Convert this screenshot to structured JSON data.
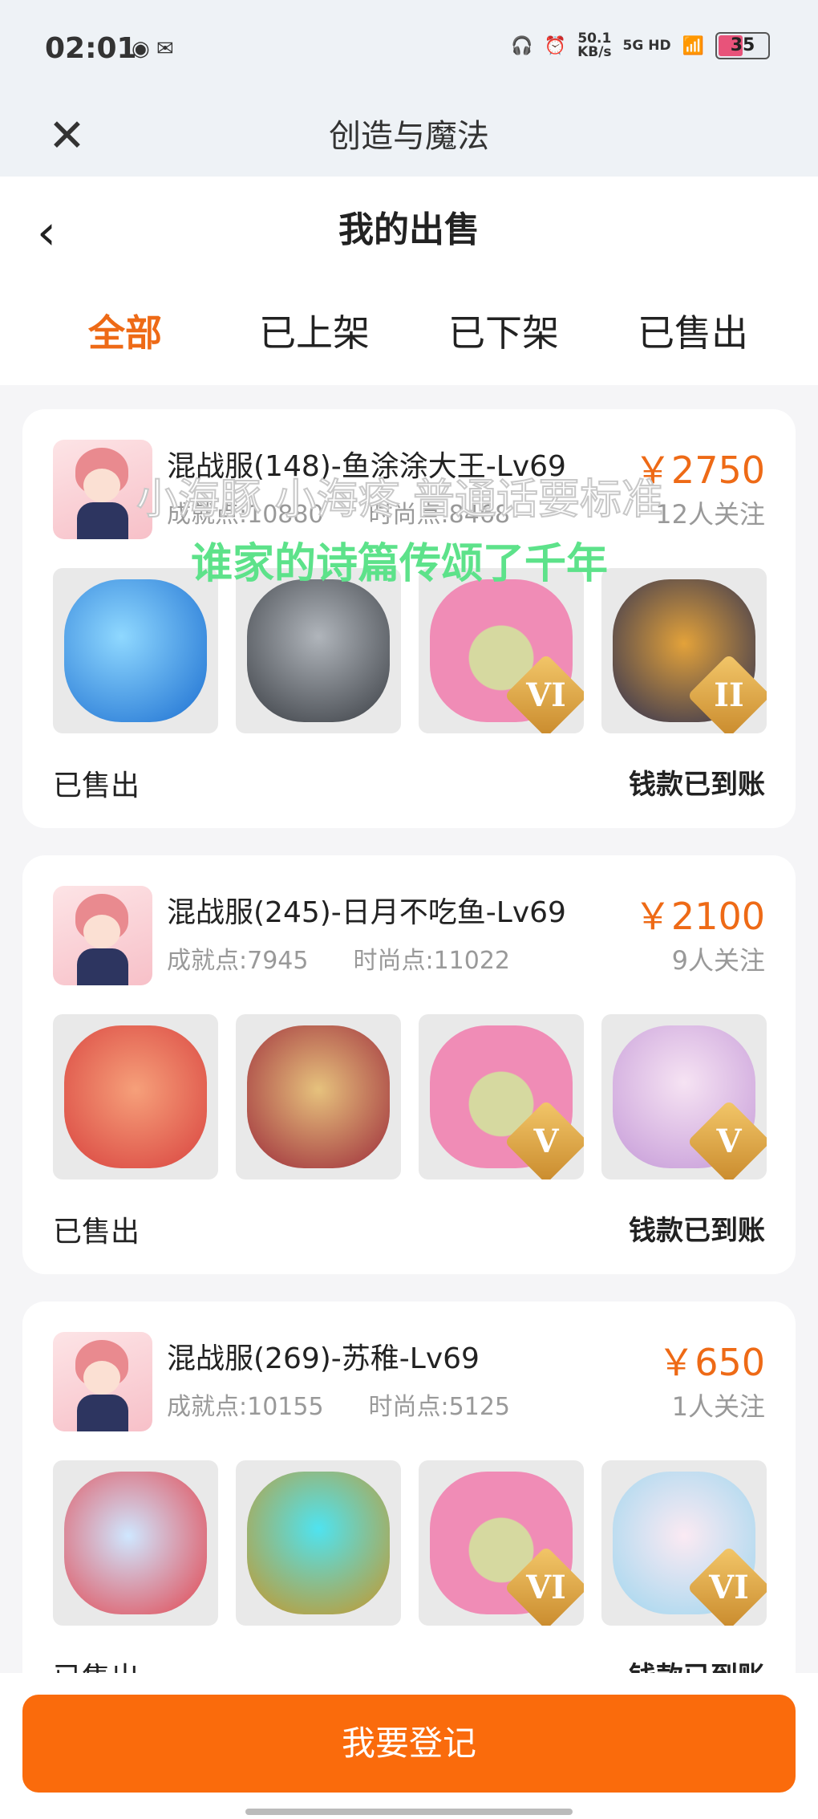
{
  "status_bar": {
    "time": "02:01",
    "speed_value": "50.1",
    "speed_unit": "KB/s",
    "network": "5G HD",
    "battery": "35"
  },
  "nav": {
    "title": "创造与魔法",
    "page_title": "我的出售"
  },
  "tabs": [
    {
      "label": "全部"
    },
    {
      "label": "已上架"
    },
    {
      "label": "已下架"
    },
    {
      "label": "已售出"
    }
  ],
  "overlay": {
    "line1": "小海豚 小海疼 普通话要标准",
    "line2": "谁家的诗篇传颂了千年"
  },
  "listings": [
    {
      "name": "混战服(148)-鱼涂涂大王-Lv69",
      "achievement": "成就点:10880",
      "fashion": "时尚点:8468",
      "price": "￥2750",
      "followers": "12人关注",
      "status": "已售出",
      "payment": "钱款已到账",
      "items": [
        {
          "icon": "whale-mount",
          "rank": ""
        },
        {
          "icon": "dragon-mount",
          "rank": ""
        },
        {
          "icon": "pink-bear",
          "rank": "VI"
        },
        {
          "icon": "golden-dragon",
          "rank": "II"
        }
      ]
    },
    {
      "name": "混战服(245)-日月不吃鱼-Lv69",
      "achievement": "成就点:7945",
      "fashion": "时尚点:11022",
      "price": "￥2100",
      "followers": "9人关注",
      "status": "已售出",
      "payment": "钱款已到账",
      "items": [
        {
          "icon": "antler-dragon",
          "rank": ""
        },
        {
          "icon": "crimson-dragon",
          "rank": ""
        },
        {
          "icon": "pink-bear",
          "rank": "V"
        },
        {
          "icon": "fox-girl",
          "rank": "V"
        }
      ]
    },
    {
      "name": "混战服(269)-苏稚-Lv69",
      "achievement": "成就点:10155",
      "fashion": "时尚点:5125",
      "price": "￥650",
      "followers": "1人关注",
      "status": "已售出",
      "payment": "钱款已到账",
      "items": [
        {
          "icon": "fish-mount",
          "rank": ""
        },
        {
          "icon": "golden-throne",
          "rank": ""
        },
        {
          "icon": "pink-bear",
          "rank": "VI"
        },
        {
          "icon": "white-rabbit",
          "rank": "VI"
        }
      ]
    }
  ],
  "register_button": "我要登记"
}
